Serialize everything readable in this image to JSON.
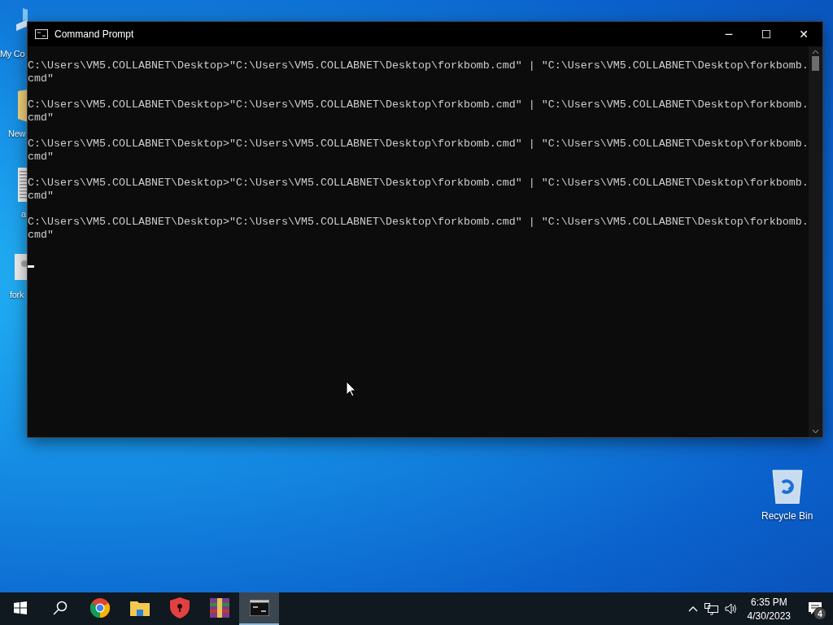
{
  "desktop_icons": [
    {
      "kind": "computer",
      "label": "My Co"
    },
    {
      "kind": "folder",
      "label": "New"
    },
    {
      "kind": "document",
      "label": "a"
    },
    {
      "kind": "script",
      "label": "fork"
    },
    {
      "kind": "recycle-bin",
      "label": "Recycle Bin"
    }
  ],
  "window": {
    "title": "Command Prompt",
    "controls": [
      "─",
      "☐",
      "✕"
    ],
    "entries": [
      {
        "line": "C:\\Users\\VM5.COLLABNET\\Desktop>\"C:\\Users\\VM5.COLLABNET\\Desktop\\forkbomb.cmd\" | \"C:\\Users\\VM5.COLLABNET\\Desktop\\forkbomb.",
        "wrap": "cmd\""
      },
      {
        "line": "C:\\Users\\VM5.COLLABNET\\Desktop>\"C:\\Users\\VM5.COLLABNET\\Desktop\\forkbomb.cmd\" | \"C:\\Users\\VM5.COLLABNET\\Desktop\\forkbomb.",
        "wrap": "cmd\""
      },
      {
        "line": "C:\\Users\\VM5.COLLABNET\\Desktop>\"C:\\Users\\VM5.COLLABNET\\Desktop\\forkbomb.cmd\" | \"C:\\Users\\VM5.COLLABNET\\Desktop\\forkbomb.",
        "wrap": "cmd\""
      },
      {
        "line": "C:\\Users\\VM5.COLLABNET\\Desktop>\"C:\\Users\\VM5.COLLABNET\\Desktop\\forkbomb.cmd\" | \"C:\\Users\\VM5.COLLABNET\\Desktop\\forkbomb.",
        "wrap": "cmd\""
      },
      {
        "line": "C:\\Users\\VM5.COLLABNET\\Desktop>\"C:\\Users\\VM5.COLLABNET\\Desktop\\forkbomb.cmd\" | \"C:\\Users\\VM5.COLLABNET\\Desktop\\forkbomb.",
        "wrap": "cmd\""
      }
    ]
  },
  "taskbar": {
    "apps": [
      {
        "kind": "start",
        "selected": false
      },
      {
        "kind": "search",
        "selected": false
      },
      {
        "kind": "chrome",
        "selected": false
      },
      {
        "kind": "explorer",
        "selected": false
      },
      {
        "kind": "shield",
        "selected": false
      },
      {
        "kind": "archive",
        "selected": false
      },
      {
        "kind": "console",
        "selected": true
      }
    ],
    "time": "6:35 PM",
    "date": "4/30/2023",
    "notifications": "4"
  }
}
